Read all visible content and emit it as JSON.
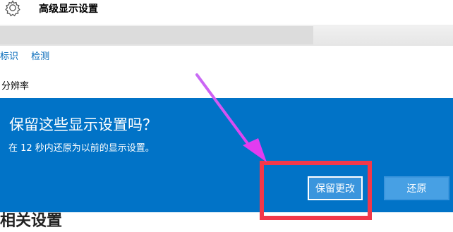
{
  "window": {
    "title": "高级显示设置",
    "icon": "gear-icon"
  },
  "links": {
    "identify": "标识",
    "detect": "检测"
  },
  "section": {
    "resolution_label": "分辨率"
  },
  "dialog": {
    "title": "保留这些显示设置吗？",
    "message": "在 12 秒内还原为以前的显示设置。",
    "keep_button": "保留更改",
    "revert_button": "还原",
    "background_color": "#0173c7"
  },
  "bottom": {
    "partial_heading": "相关设置"
  },
  "annotation": {
    "arrow_color": "#e040fb",
    "highlight_color": "#f2384a"
  }
}
